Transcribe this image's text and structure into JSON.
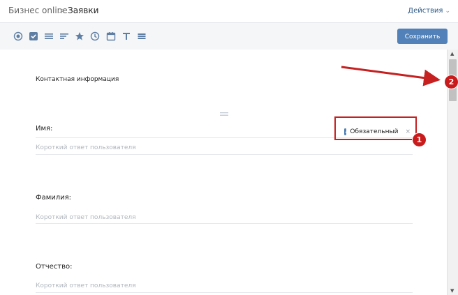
{
  "breadcrumb": {
    "root": "Бизнес online",
    "separator": ">",
    "current": "Заявки"
  },
  "header": {
    "actions_label": "Действия",
    "actions_chevron": "⌄"
  },
  "toolbar": {
    "tools": [
      {
        "icon": "radio-icon"
      },
      {
        "icon": "checkbox-icon"
      },
      {
        "icon": "list-icon"
      },
      {
        "icon": "paragraph-icon"
      },
      {
        "icon": "rating-icon"
      },
      {
        "icon": "clock-icon"
      },
      {
        "icon": "calendar-icon"
      },
      {
        "icon": "text-icon"
      },
      {
        "icon": "menu-icon"
      }
    ],
    "save_label": "Сохранить",
    "icon_color": "#5f7ea3",
    "accent": "#5181b8"
  },
  "form": {
    "section_title": "Контактная информация",
    "fields": [
      {
        "label": "Имя:",
        "placeholder": "Короткий ответ пользователя"
      },
      {
        "label": "Фамилия:",
        "placeholder": "Короткий ответ пользователя"
      },
      {
        "label": "Отчество:",
        "placeholder": "Короткий ответ пользователя"
      }
    ],
    "required_label": "Обязательный",
    "required_checked": true,
    "close_glyph": "×"
  },
  "annotations": {
    "badge_1": "1",
    "badge_2": "2",
    "highlight_color": "#c62020"
  }
}
